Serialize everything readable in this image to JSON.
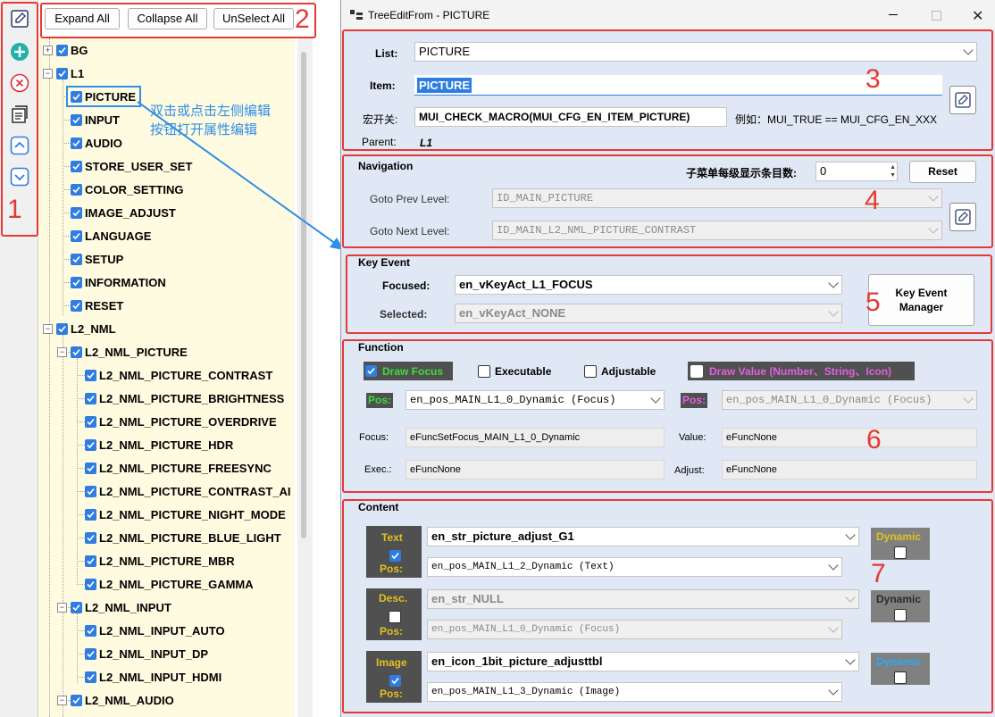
{
  "annotations": {
    "n1": "1",
    "n2": "2",
    "n3": "3",
    "n4": "4",
    "n5": "5",
    "n6": "6",
    "n7": "7",
    "hint_line1": "双击或点击左侧编辑",
    "hint_line2": "按钮打开属性编辑"
  },
  "top_buttons": {
    "expand": "Expand All",
    "collapse": "Collapse All",
    "unselect": "UnSelect All"
  },
  "tree": [
    {
      "label": "BG",
      "level": 0,
      "expander": "+"
    },
    {
      "label": "L1",
      "level": 0,
      "expander": "-"
    },
    {
      "label": "PICTURE",
      "level": 1,
      "selected": true
    },
    {
      "label": "INPUT",
      "level": 1
    },
    {
      "label": "AUDIO",
      "level": 1
    },
    {
      "label": "STORE_USER_SET",
      "level": 1
    },
    {
      "label": "COLOR_SETTING",
      "level": 1
    },
    {
      "label": "IMAGE_ADJUST",
      "level": 1
    },
    {
      "label": "LANGUAGE",
      "level": 1
    },
    {
      "label": "SETUP",
      "level": 1
    },
    {
      "label": "INFORMATION",
      "level": 1
    },
    {
      "label": "RESET",
      "level": 1
    },
    {
      "label": "L2_NML",
      "level": 0,
      "expander": "-"
    },
    {
      "label": "L2_NML_PICTURE",
      "level": 1,
      "expander": "-"
    },
    {
      "label": "L2_NML_PICTURE_CONTRAST",
      "level": 2
    },
    {
      "label": "L2_NML_PICTURE_BRIGHTNESS",
      "level": 2
    },
    {
      "label": "L2_NML_PICTURE_OVERDRIVE",
      "level": 2
    },
    {
      "label": "L2_NML_PICTURE_HDR",
      "level": 2
    },
    {
      "label": "L2_NML_PICTURE_FREESYNC",
      "level": 2
    },
    {
      "label": "L2_NML_PICTURE_CONTRAST_AI",
      "level": 2
    },
    {
      "label": "L2_NML_PICTURE_NIGHT_MODE",
      "level": 2
    },
    {
      "label": "L2_NML_PICTURE_BLUE_LIGHT",
      "level": 2
    },
    {
      "label": "L2_NML_PICTURE_MBR",
      "level": 2
    },
    {
      "label": "L2_NML_PICTURE_GAMMA",
      "level": 2
    },
    {
      "label": "L2_NML_INPUT",
      "level": 1,
      "expander": "-"
    },
    {
      "label": "L2_NML_INPUT_AUTO",
      "level": 2
    },
    {
      "label": "L2_NML_INPUT_DP",
      "level": 2
    },
    {
      "label": "L2_NML_INPUT_HDMI",
      "level": 2
    },
    {
      "label": "L2_NML_AUDIO",
      "level": 1,
      "expander": "-"
    }
  ],
  "window": {
    "title": "TreeEditFrom - PICTURE"
  },
  "props": {
    "list_label": "List:",
    "list_value": "PICTURE",
    "item_label": "Item:",
    "item_value": "PICTURE",
    "macro_label": "宏开关:",
    "macro_value": "MUI_CHECK_MACRO(MUI_CFG_EN_ITEM_PICTURE)",
    "macro_example": "例如：MUI_TRUE == MUI_CFG_EN_XXX",
    "parent_label": "Parent:",
    "parent_value": "L1"
  },
  "navigation": {
    "title": "Navigation",
    "count_label": "子菜单每级显示条目数:",
    "count_value": "0",
    "reset": "Reset",
    "prev_label": "Goto Prev  Level:",
    "prev_value": "ID_MAIN_PICTURE",
    "next_label": "Goto Next Level:",
    "next_value": "ID_MAIN_L2_NML_PICTURE_CONTRAST"
  },
  "key_event": {
    "title": "Key Event",
    "focused_label": "Focused:",
    "focused_value": "en_vKeyAct_L1_FOCUS",
    "selected_label": "Selected:",
    "selected_value": "en_vKeyAct_NONE",
    "manager": "Key Event Manager"
  },
  "function": {
    "title": "Function",
    "draw_focus": "Draw Focus",
    "executable": "Executable",
    "adjustable": "Adjustable",
    "draw_value": "Draw Value (Number、String、Icon)",
    "pos_label": "Pos:",
    "pos_value": "en_pos_MAIN_L1_0_Dynamic (Focus)",
    "pos2_value": "en_pos_MAIN_L1_0_Dynamic (Focus)",
    "focus_label": "Focus:",
    "focus_value": "eFuncSetFocus_MAIN_L1_0_Dynamic",
    "value_label": "Value:",
    "value_value": "eFuncNone",
    "exec_label": "Exec.:",
    "exec_value": "eFuncNone",
    "adjust_label": "Adjust:",
    "adjust_value": "eFuncNone"
  },
  "content": {
    "title": "Content",
    "pos_label": "Pos:",
    "dynamic": "Dynamic",
    "text_label": "Text",
    "text_value": "en_str_picture_adjust_G1",
    "text_pos": "en_pos_MAIN_L1_2_Dynamic (Text)",
    "desc_label": "Desc.",
    "desc_value": "en_str_NULL",
    "desc_pos": "en_pos_MAIN_L1_0_Dynamic (Focus)",
    "image_label": "Image",
    "image_value": "en_icon_1bit_picture_adjusttbl",
    "image_pos": "en_pos_MAIN_L1_3_Dynamic (Image)"
  },
  "colors": {
    "accent": "#2f7de1",
    "annotation_red": "#e53935",
    "tree_bg": "#fffbe0",
    "dialog_bg": "#dfe8f4"
  }
}
